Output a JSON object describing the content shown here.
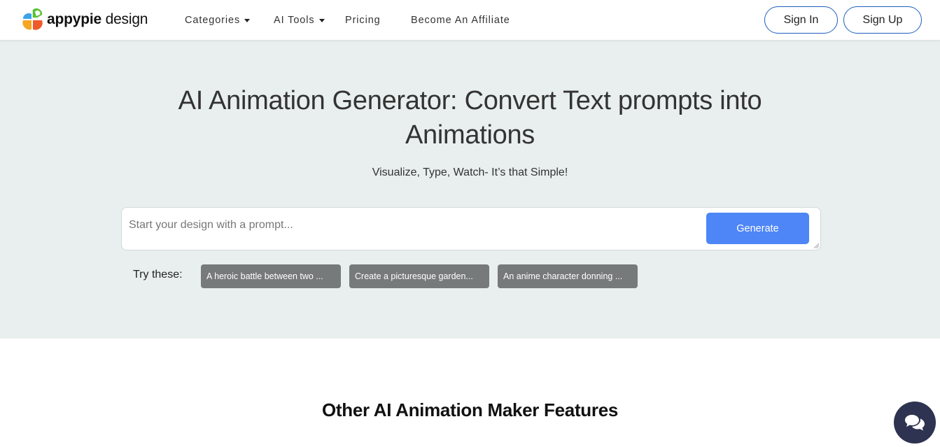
{
  "header": {
    "logo": {
      "brand_bold": "appypie",
      "brand_light": " design",
      "icon": "appypie-logo-icon"
    },
    "nav": [
      {
        "label": "Categories",
        "has_dropdown": true
      },
      {
        "label": "AI Tools",
        "has_dropdown": true
      },
      {
        "label": "Pricing",
        "has_dropdown": false
      },
      {
        "label": "Become An Affiliate",
        "has_dropdown": false
      }
    ],
    "sign_in": "Sign In",
    "sign_up": "Sign Up"
  },
  "hero": {
    "title": "AI Animation Generator: Convert Text prompts into Animations",
    "title_line1": "AI Animation Generator: Convert Text prompts into",
    "title_line2": "Animations",
    "subtitle": "Visualize, Type, Watch- It’s that Simple!",
    "prompt": {
      "value": "",
      "placeholder": "Start your design with a prompt..."
    },
    "generate_label": "Generate",
    "try_label": "Try these:",
    "suggestions": [
      "A heroic battle between two ...",
      "Create a picturesque garden...",
      "An anime character donning ..."
    ]
  },
  "features": {
    "title": "Other AI Animation Maker Features"
  },
  "chat": {
    "icon": "chat-bubbles-icon"
  },
  "colors": {
    "hero_bg": "#e8efee",
    "primary": "#4e86f7",
    "outline": "#1f5fbf",
    "chip_bg": "#777a7a",
    "chat_bg": "#2d3350"
  }
}
